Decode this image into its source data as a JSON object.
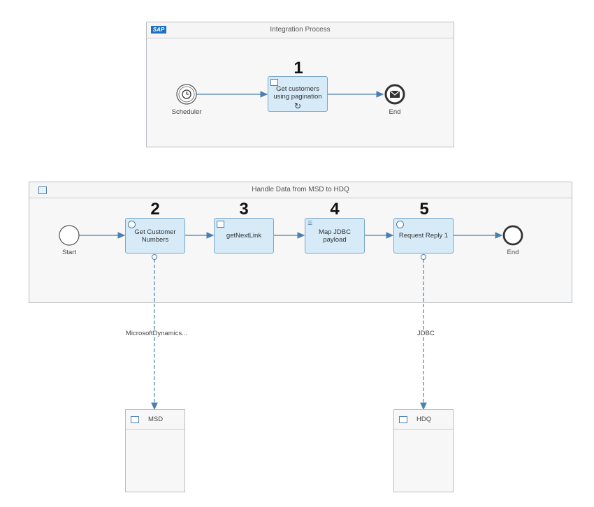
{
  "integration_process": {
    "title": "Integration Process",
    "start_event": "Scheduler",
    "task": {
      "number": "1",
      "label_line1": "Get customers",
      "label_line2": "using pagination"
    },
    "end_event": "End"
  },
  "local_process": {
    "title": "Handle Data from MSD to HDQ",
    "start_event": "Start",
    "end_event": "End",
    "tasks": [
      {
        "number": "2",
        "label_line1": "Get Customer",
        "label_line2": "Numbers"
      },
      {
        "number": "3",
        "label_line1": "getNextLink",
        "label_line2": ""
      },
      {
        "number": "4",
        "label_line1": "Map JDBC",
        "label_line2": "payload"
      },
      {
        "number": "5",
        "label_line1": "Request Reply 1",
        "label_line2": ""
      }
    ]
  },
  "connections": [
    {
      "label": "MicrosoftDynamics..."
    },
    {
      "label": "JDBC"
    }
  ],
  "systems": [
    {
      "name": "MSD"
    },
    {
      "name": "HDQ"
    }
  ],
  "colors": {
    "task_fill": "#d6eaf8",
    "task_border": "#7aa6c8",
    "line": "#4a7fb0"
  }
}
